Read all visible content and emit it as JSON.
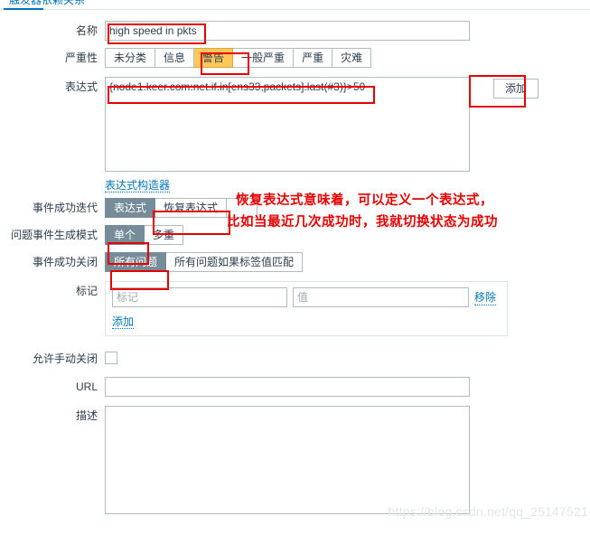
{
  "tabs": [
    {
      "label": "触发器",
      "active": true
    },
    {
      "label": "依赖关系",
      "active": false
    }
  ],
  "form": {
    "name": {
      "label": "名称",
      "value": "high speed in pkts",
      "placeholder": ""
    },
    "severity": {
      "label": "严重性",
      "options": [
        "未分类",
        "信息",
        "警告",
        "一般严重",
        "严重",
        "灾难"
      ],
      "selected": "警告",
      "selected_color": "#ffc859"
    },
    "expression": {
      "label": "表达式",
      "value": "{node1.keer.com:net.if.in[ens33,packets].last(#3)}>50",
      "add_button": "添加",
      "constructor_link": "表达式构造器"
    },
    "ok_event_generation": {
      "label": "事件成功迭代",
      "options": [
        "表达式",
        "恢复表达式"
      ],
      "selected": "表达式"
    },
    "problem_event_generation_mode": {
      "label": "问题事件生成模式",
      "options": [
        "单个",
        "多重"
      ],
      "selected": "单个"
    },
    "ok_event_closes": {
      "label": "事件成功关闭",
      "options": [
        "所有问题",
        "所有问题如果标签值匹配"
      ],
      "selected": "所有问题"
    },
    "tags": {
      "label": "标记",
      "tag_placeholder": "标记",
      "tag_value": "",
      "value_placeholder": "值",
      "value_value": "",
      "remove_link": "移除",
      "add_link": "添加"
    },
    "allow_manual_close": {
      "label": "允许手动关闭",
      "checked": false
    },
    "url": {
      "label": "URL",
      "value": "",
      "placeholder": ""
    },
    "description": {
      "label": "描述",
      "value": "",
      "placeholder": ""
    }
  },
  "annotations": {
    "note_line1": "恢复表达式意味着，可以定义一个表达式，",
    "note_line2": "比如当最近几次成功时，我就切换状态为成功",
    "color": "#e60000"
  },
  "watermark": "https://blog.csdn.net/qq_25147521"
}
